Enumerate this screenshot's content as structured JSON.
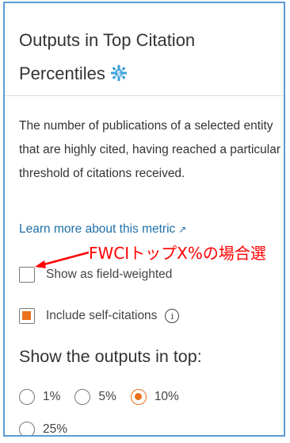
{
  "panel": {
    "title": "Outputs in Top Citation Percentiles",
    "description": "The number of publications of a selected entity that are highly cited, having reached a particular threshold of citations received.",
    "learn_more": "Learn more about this metric"
  },
  "options": {
    "field_weighted": {
      "label": "Show as field-weighted",
      "checked": false
    },
    "self_citations": {
      "label": "Include self-citations",
      "checked": true
    }
  },
  "percentiles": {
    "heading": "Show the outputs in top:",
    "options": [
      "1%",
      "5%",
      "10%",
      "25%"
    ],
    "selected": "10%"
  },
  "annotation": {
    "text": "FWCIトップX%の場合選",
    "color": "#ff0000"
  },
  "colors": {
    "accent": "#e9711c",
    "link": "#1f6fa8",
    "frame": "#5b9bd5"
  },
  "icons": {
    "title_icon": "scival-icon",
    "link_icon": "external-link-icon",
    "info": "info-icon"
  }
}
